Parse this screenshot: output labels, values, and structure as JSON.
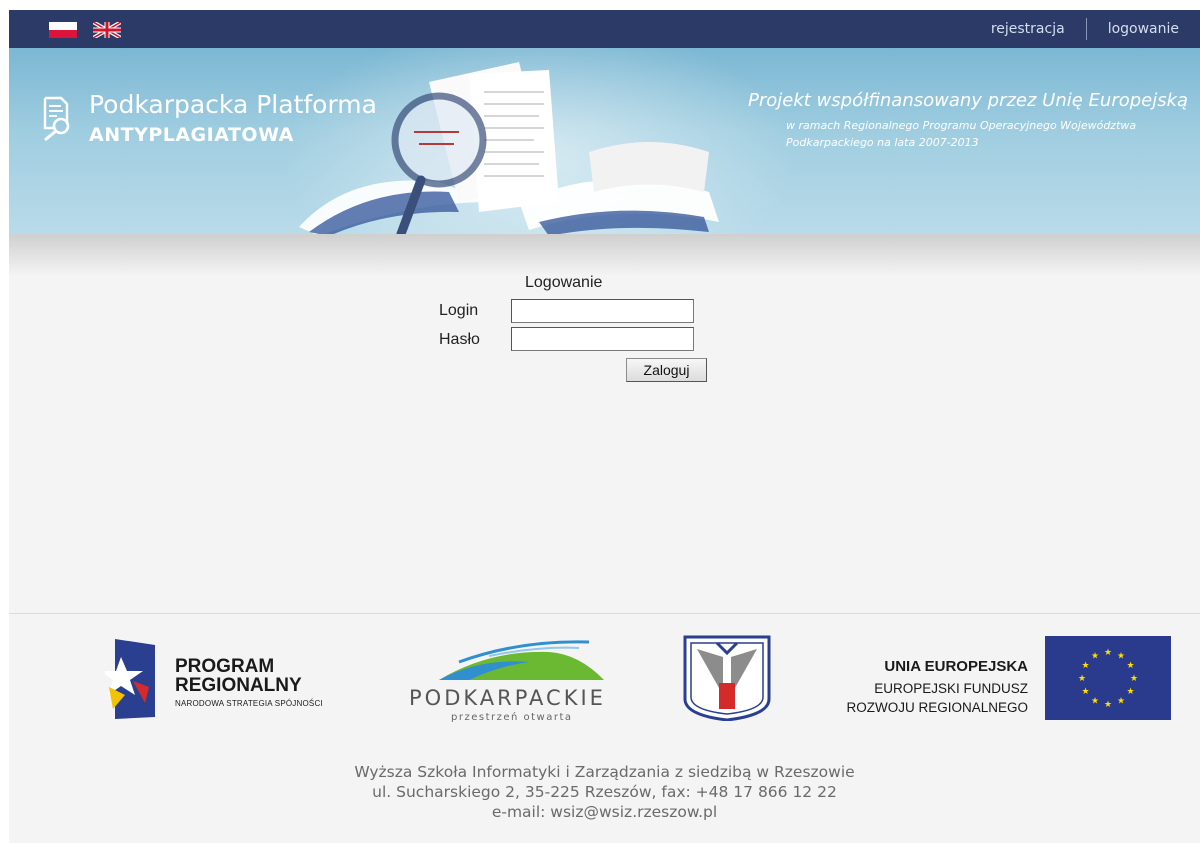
{
  "topbar": {
    "languages": [
      {
        "name": "polish-flag-icon"
      },
      {
        "name": "uk-flag-icon"
      }
    ],
    "links": {
      "register": "rejestracja",
      "login": "logowanie"
    }
  },
  "banner": {
    "brand_line1": "Podkarpacka Platforma",
    "brand_line2": "ANTYPLAGIATOWA",
    "eu_line1": "Projekt współfinansowany przez Unię Europejską",
    "eu_line2": "w ramach Regionalnego Programu Operacyjnego Województwa Podkarpackiego na lata 2007-2013"
  },
  "login": {
    "title": "Logowanie",
    "login_label": "Login",
    "password_label": "Hasło",
    "login_value": "",
    "password_value": "",
    "submit": "Zaloguj"
  },
  "logos": {
    "program_regionalny_line1": "PROGRAM",
    "program_regionalny_line2": "REGIONALNY",
    "program_regionalny_sub": "NARODOWA STRATEGIA SPÓJNOŚCI",
    "podkarpackie": "PODKARPACKIE",
    "podkarpackie_sub": "przestrzeń otwarta",
    "ue_title": "UNIA EUROPEJSKA",
    "ue_sub1": "EUROPEJSKI FUNDUSZ",
    "ue_sub2": "ROZWOJU REGIONALNEGO"
  },
  "footer": {
    "line1": "Wyższa Szkoła Informatyki i Zarządzania z siedzibą w Rzeszowie",
    "line2": "ul. Sucharskiego 2, 35-225 Rzeszów, fax: +48 17 866 12 22",
    "line3": "e-mail: wsiz@wsiz.rzeszow.pl"
  },
  "colors": {
    "topbar": "#2b3a66",
    "banner": "#9fcde0",
    "page_bg": "#f4f4f4",
    "eu_flag": "#2a3a8c",
    "eu_star": "#ffdd00"
  }
}
